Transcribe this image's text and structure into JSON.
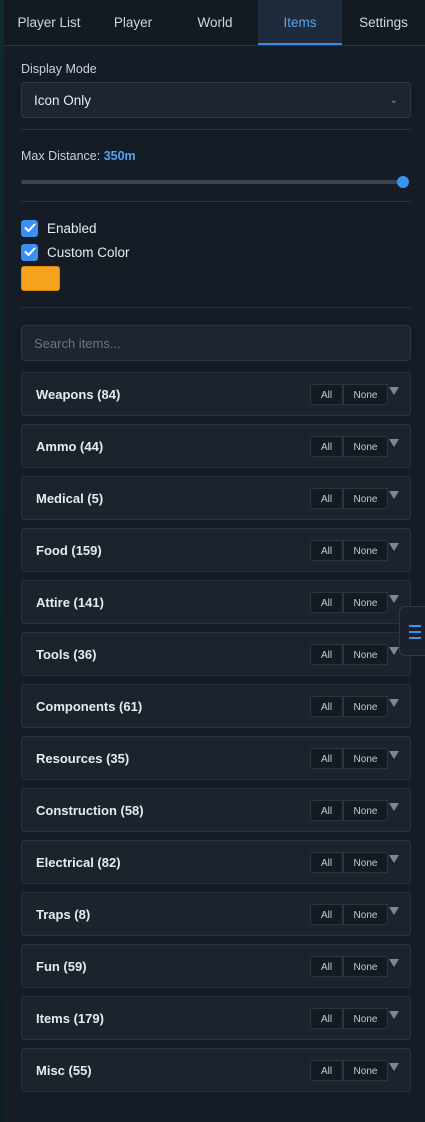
{
  "tabs": [
    {
      "label": "Player List"
    },
    {
      "label": "Player"
    },
    {
      "label": "World"
    },
    {
      "label": "Items",
      "active": true
    },
    {
      "label": "Settings"
    }
  ],
  "display_mode": {
    "label": "Display Mode",
    "value": "Icon Only"
  },
  "max_distance": {
    "label": "Max Distance:",
    "value": "350",
    "unit": "m",
    "fraction": 1.0
  },
  "options": {
    "enabled": {
      "label": "Enabled",
      "checked": true
    },
    "custom_color": {
      "label": "Custom Color",
      "checked": true,
      "color": "#f7a21c"
    }
  },
  "search": {
    "placeholder": "Search items..."
  },
  "button_labels": {
    "all": "All",
    "none": "None"
  },
  "categories": [
    {
      "title": "Weapons (84)"
    },
    {
      "title": "Ammo (44)"
    },
    {
      "title": "Medical (5)"
    },
    {
      "title": "Food (159)"
    },
    {
      "title": "Attire (141)"
    },
    {
      "title": "Tools (36)"
    },
    {
      "title": "Components (61)"
    },
    {
      "title": "Resources (35)"
    },
    {
      "title": "Construction (58)"
    },
    {
      "title": "Electrical (82)"
    },
    {
      "title": "Traps (8)"
    },
    {
      "title": "Fun (59)"
    },
    {
      "title": "Items (179)"
    },
    {
      "title": "Misc (55)"
    }
  ],
  "icons": {
    "dropdown": "chevron-down-icon",
    "check": "check-icon",
    "expand": "triangle-down-icon",
    "menu": "menu-icon"
  },
  "colors": {
    "accent": "#3c8fe8",
    "background": "#161c25",
    "swatch": "#f7a21c"
  }
}
